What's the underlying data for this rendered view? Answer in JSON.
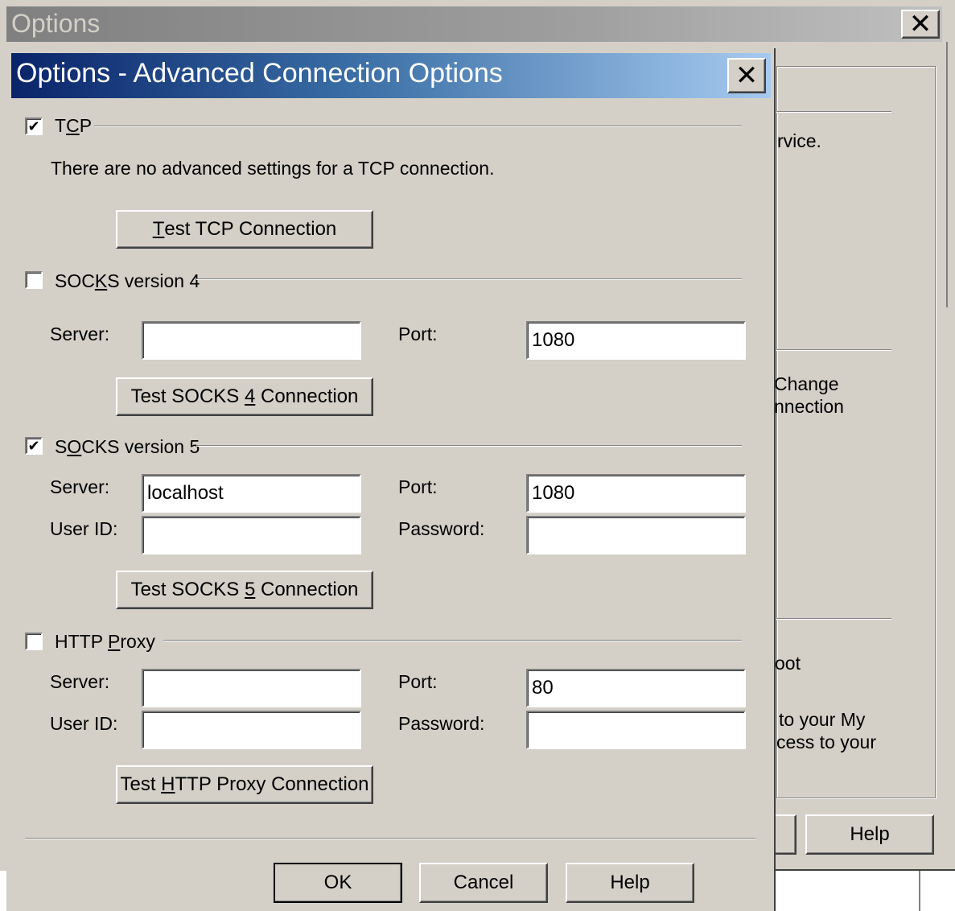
{
  "outer": {
    "title": "Options",
    "partial_texts": [
      "rvice.",
      "Change",
      "nnection",
      "oot",
      "to your My",
      "cess to your"
    ],
    "help_label": "Help"
  },
  "dialog": {
    "title": "Options - Advanced Connection Options",
    "tcp": {
      "label_pre": "T",
      "label_u": "C",
      "label_post": "P",
      "checked": true,
      "note": "There are no advanced settings for a TCP connection.",
      "test_pre": "",
      "test_u": "T",
      "test_post": "est TCP Connection"
    },
    "socks4": {
      "label_pre": "SOC",
      "label_u": "K",
      "label_post": "S version 4",
      "checked": false,
      "server_label": "Server:",
      "server_value": "",
      "port_label": "Port:",
      "port_value": "1080",
      "test_pre": "Test SOCKS ",
      "test_u": "4",
      "test_post": " Connection"
    },
    "socks5": {
      "label_pre": "S",
      "label_u": "O",
      "label_post": "CKS version 5",
      "checked": true,
      "server_label": "Server:",
      "server_value": "localhost",
      "port_label": "Port:",
      "port_value": "1080",
      "user_label": "User ID:",
      "user_value": "",
      "password_label": "Password:",
      "password_value": "",
      "test_pre": "Test SOCKS ",
      "test_u": "5",
      "test_post": " Connection"
    },
    "http": {
      "label_pre": "HTTP ",
      "label_u": "P",
      "label_post": "roxy",
      "checked": false,
      "server_label": "Server:",
      "server_value": "",
      "port_label": "Port:",
      "port_value": "80",
      "user_label": "User ID:",
      "user_value": "",
      "password_label": "Password:",
      "password_value": "",
      "test_pre": "Test ",
      "test_u": "H",
      "test_post": "TTP Proxy Connection"
    },
    "ok_label": "OK",
    "cancel_label": "Cancel",
    "help_label": "Help"
  },
  "colors": {
    "face": "#d4d0c8",
    "active_title_start": "#0a246a",
    "active_title_end": "#a6caf0",
    "inactive_title": "#808080"
  }
}
